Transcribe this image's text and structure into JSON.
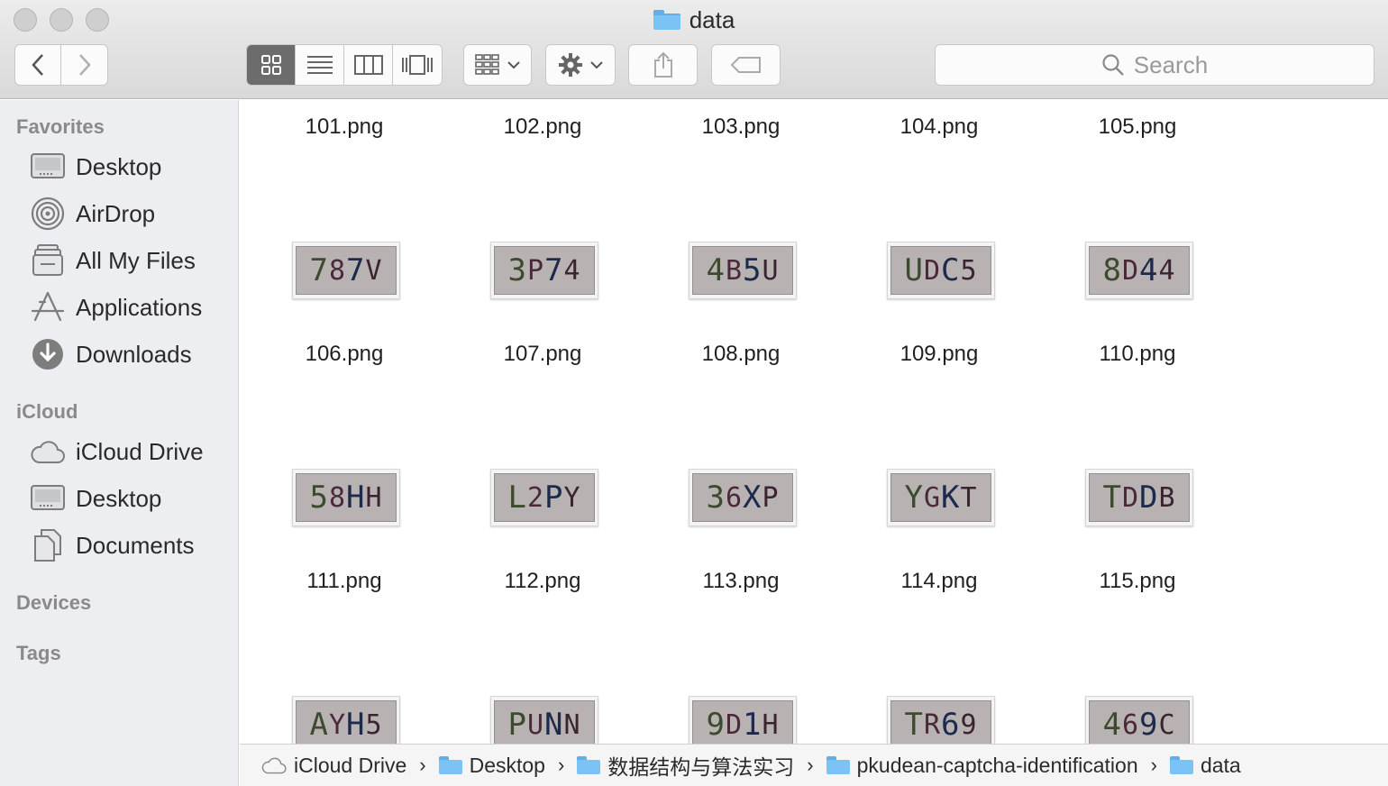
{
  "window": {
    "title": "data"
  },
  "toolbar": {
    "search_placeholder": "Search",
    "view_modes": [
      "icon-view",
      "list-view",
      "column-view",
      "cover-flow-view"
    ],
    "active_view": "icon-view"
  },
  "sidebar": {
    "sections": [
      {
        "title": "Favorites",
        "items": [
          {
            "label": "Desktop",
            "icon": "desktop-icon"
          },
          {
            "label": "AirDrop",
            "icon": "airdrop-icon"
          },
          {
            "label": "All My Files",
            "icon": "all-files-icon"
          },
          {
            "label": "Applications",
            "icon": "applications-icon"
          },
          {
            "label": "Downloads",
            "icon": "downloads-icon"
          }
        ]
      },
      {
        "title": "iCloud",
        "items": [
          {
            "label": "iCloud Drive",
            "icon": "cloud-icon"
          },
          {
            "label": "Desktop",
            "icon": "desktop-icon"
          },
          {
            "label": "Documents",
            "icon": "documents-icon"
          }
        ]
      },
      {
        "title": "Devices",
        "items": []
      },
      {
        "title": "Tags",
        "items": []
      }
    ]
  },
  "files": {
    "row0_names": [
      "101.png",
      "102.png",
      "103.png",
      "104.png",
      "105.png"
    ],
    "rows": [
      {
        "names": [
          "106.png",
          "107.png",
          "108.png",
          "109.png",
          "110.png"
        ],
        "captchas": [
          "787V",
          "3P74",
          "4B5U",
          "UDC5",
          "8D44"
        ]
      },
      {
        "names": [
          "111.png",
          "112.png",
          "113.png",
          "114.png",
          "115.png"
        ],
        "captchas": [
          "58HH",
          "L2PY",
          "36XP",
          "YGKT",
          "TDDB"
        ]
      },
      {
        "names": [],
        "captchas": [
          "AYH5",
          "PUNN",
          "9D1H",
          "TR69",
          "469C"
        ]
      }
    ]
  },
  "pathbar": {
    "items": [
      {
        "label": "iCloud Drive",
        "icon": "cloud-icon"
      },
      {
        "label": "Desktop",
        "icon": "folder-icon"
      },
      {
        "label": "数据结构与算法实习",
        "icon": "folder-icon"
      },
      {
        "label": "pkudean-captcha-identification",
        "icon": "folder-icon"
      },
      {
        "label": "data",
        "icon": "folder-icon"
      }
    ]
  }
}
